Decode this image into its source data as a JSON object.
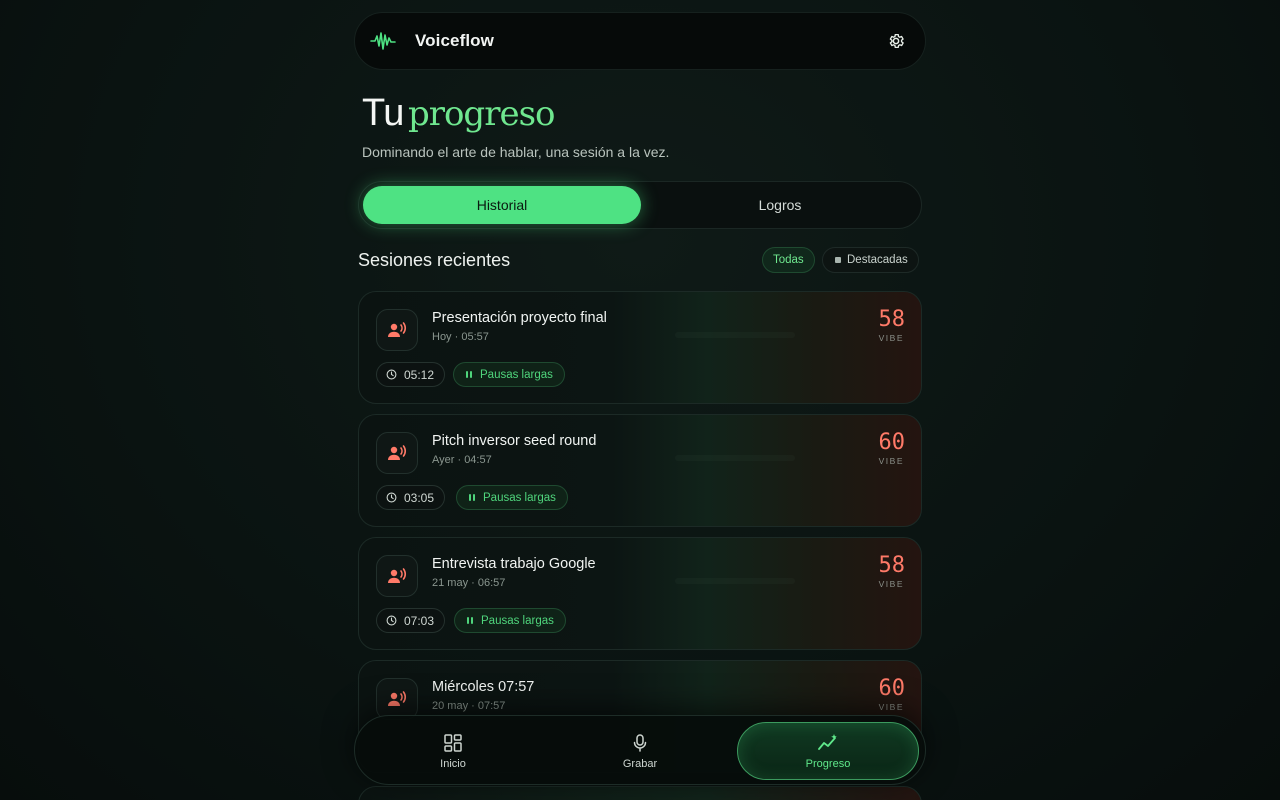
{
  "app": {
    "name": "Voiceflow"
  },
  "heading": {
    "prefix": "Tu",
    "accent": "progreso",
    "subtitle": "Dominando el arte de hablar, una sesión a la vez."
  },
  "tabs": [
    {
      "label": "Historial",
      "active": true
    },
    {
      "label": "Logros",
      "active": false
    }
  ],
  "section": {
    "title": "Sesiones recientes",
    "filters": [
      {
        "label": "Todas",
        "active": true
      },
      {
        "label": "Destacadas",
        "active": false
      }
    ]
  },
  "sessions": [
    {
      "name": "Presentación proyecto final",
      "meta": "Hoy · 05:57",
      "score": "58",
      "score_label": "VIBE",
      "duration": "05:12",
      "tag": "Pausas largas"
    },
    {
      "name": "Pitch inversor seed round",
      "meta": "Ayer · 04:57",
      "score": "60",
      "score_label": "VIBE",
      "duration": "03:05",
      "tag": "Pausas largas"
    },
    {
      "name": "Entrevista trabajo Google",
      "meta": "21 may · 06:57",
      "score": "58",
      "score_label": "VIBE",
      "duration": "07:03",
      "tag": "Pausas largas"
    },
    {
      "name": "Miércoles 07:57",
      "meta": "20 may · 07:57",
      "score": "60",
      "score_label": "VIBE"
    }
  ],
  "nav": [
    {
      "label": "Inicio",
      "icon": "dashboard-icon",
      "active": false
    },
    {
      "label": "Grabar",
      "icon": "microphone-icon",
      "active": false
    },
    {
      "label": "Progreso",
      "icon": "trend-up-sparkle-icon",
      "active": true
    }
  ],
  "colors": {
    "accent": "#4ee283",
    "score": "#ff7a68",
    "background": "#0b1412"
  }
}
